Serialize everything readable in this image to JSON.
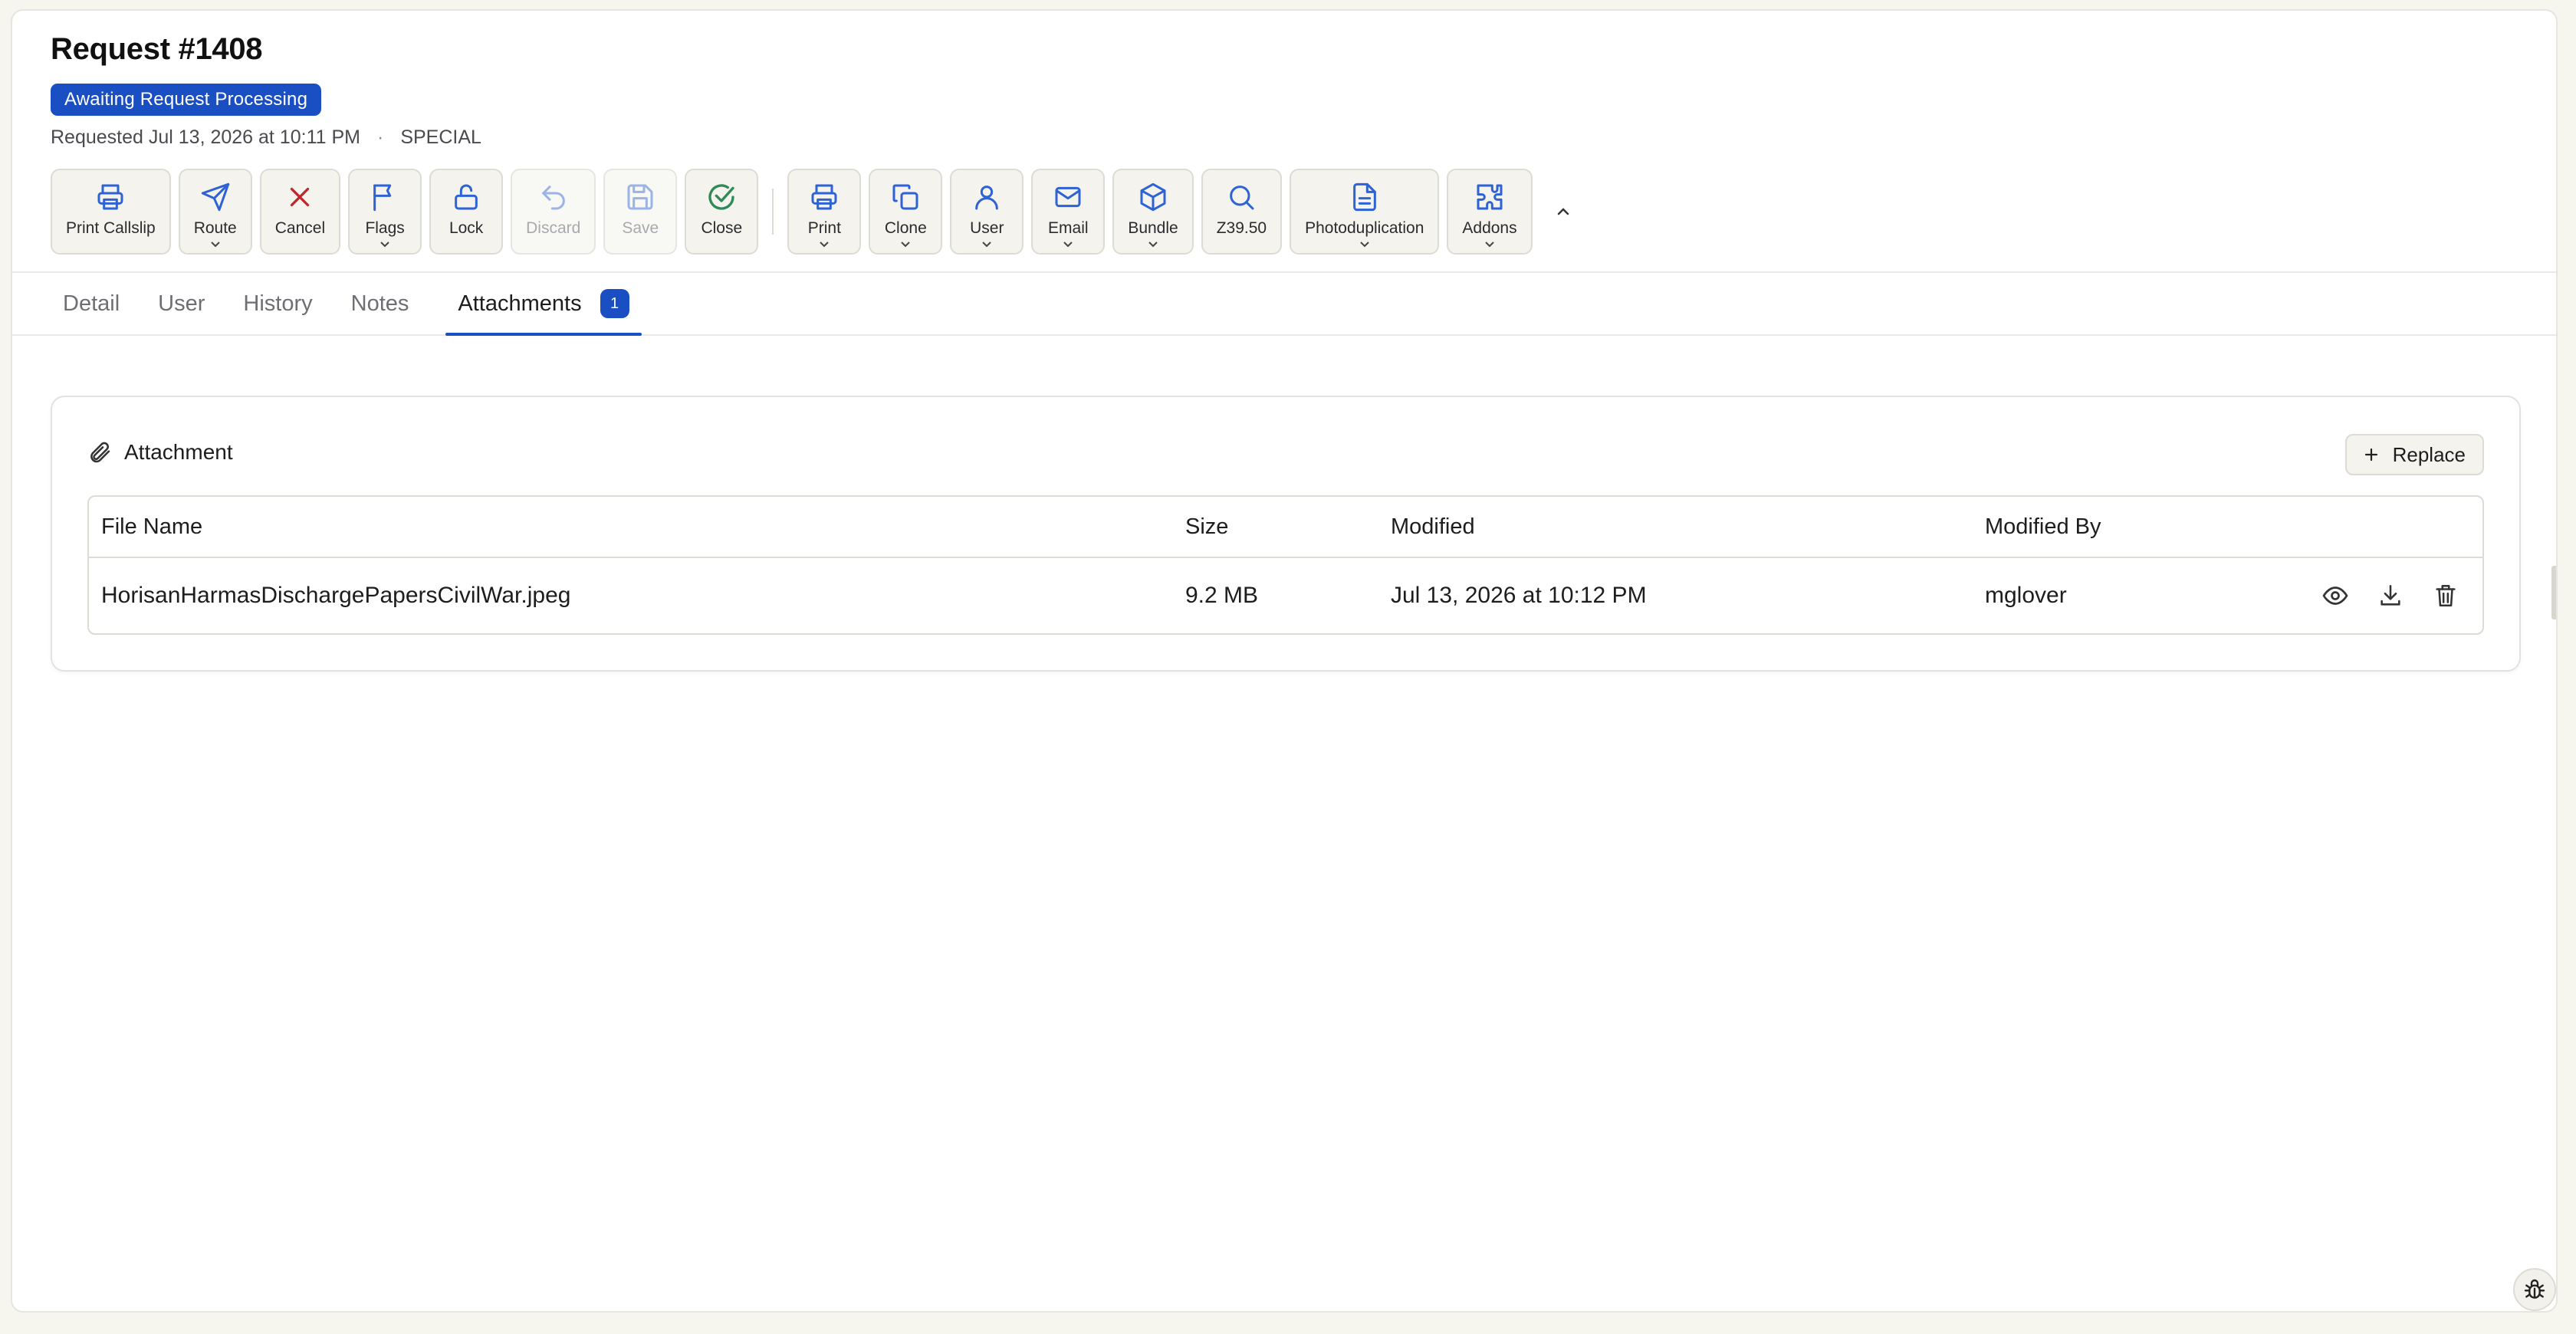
{
  "header": {
    "title": "Request #1408",
    "status": "Awaiting Request Processing",
    "requested": "Requested Jul 13, 2026 at 10:11 PM",
    "separator": "·",
    "type": "SPECIAL"
  },
  "toolbar": {
    "print_callslip": "Print Callslip",
    "route": "Route",
    "cancel": "Cancel",
    "flags": "Flags",
    "lock": "Lock",
    "discard": "Discard",
    "save": "Save",
    "close": "Close",
    "print": "Print",
    "clone": "Clone",
    "user": "User",
    "email": "Email",
    "bundle": "Bundle",
    "z3950": "Z39.50",
    "photoduplication": "Photoduplication",
    "addons": "Addons"
  },
  "tabs": {
    "detail": "Detail",
    "user": "User",
    "history": "History",
    "notes": "Notes",
    "attachments": "Attachments",
    "attachments_count": "1"
  },
  "attachment": {
    "title": "Attachment",
    "replace_label": "Replace",
    "columns": {
      "file_name": "File Name",
      "size": "Size",
      "modified": "Modified",
      "modified_by": "Modified By"
    },
    "rows": [
      {
        "file_name": "HorisanHarmasDischargePapersCivilWar.jpeg",
        "size": "9.2 MB",
        "modified": "Jul 13, 2026 at 10:12 PM",
        "modified_by": "mglover"
      }
    ]
  },
  "colors": {
    "accent": "#1a4fc4",
    "cancel_red": "#c0262d",
    "close_green": "#2e8b57",
    "icon_blue": "#2e63d6"
  }
}
